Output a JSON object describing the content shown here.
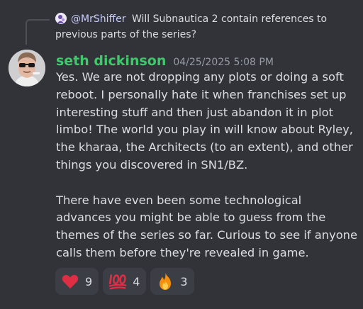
{
  "reply": {
    "author": "@MrShiffer",
    "text": "Will Subnautica 2 contain references to previous parts of the series?"
  },
  "message": {
    "author": "seth dickinson",
    "timestamp": "04/25/2025 5:08 PM",
    "author_color": "#3fc96a",
    "paragraph_1": "Yes. We are not dropping any plots or doing a soft reboot. I personally hate it when franchises set up interesting stuff and then just abandon it in plot limbo! The world you play in will know about Ryley, the kharaa, the Architects (to an extent), and other things you discovered in SN1/BZ.",
    "paragraph_2": "There have even been some technological advances you might be able to guess from the themes of the series so far. Curious to see if anyone calls them before they're revealed in game."
  },
  "reactions": [
    {
      "emoji": "heart-icon",
      "count": "9"
    },
    {
      "emoji": "hundred-points-icon",
      "count": "4"
    },
    {
      "emoji": "fire-icon",
      "count": "3"
    }
  ]
}
